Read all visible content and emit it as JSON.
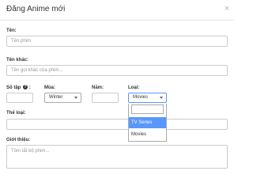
{
  "modal": {
    "title": "Đăng Anime mới",
    "close_label": "×"
  },
  "fields": {
    "name": {
      "label": "Tên:",
      "placeholder": "Tên phim"
    },
    "other_name": {
      "label": "Tên khác:",
      "placeholder": "Tên gọi khác của phim..."
    },
    "episodes": {
      "label": "Số tập",
      "help": "?",
      "suffix": ":"
    },
    "season": {
      "label": "Mùa:",
      "value": "Winter"
    },
    "year": {
      "label": "Năm:"
    },
    "type": {
      "label": "Loại:",
      "value": "Movies",
      "options": [
        "TV Series",
        "Movies"
      ],
      "highlighted": "TV Series"
    },
    "genre": {
      "label": "Thể loại:"
    },
    "intro": {
      "label": "Giới thiệu:",
      "placeholder": "Tóm tắt bộ phim..."
    }
  },
  "icons": {
    "close": "close-icon",
    "help": "help-circle-icon",
    "dropdown": "chevron-down-icon"
  }
}
